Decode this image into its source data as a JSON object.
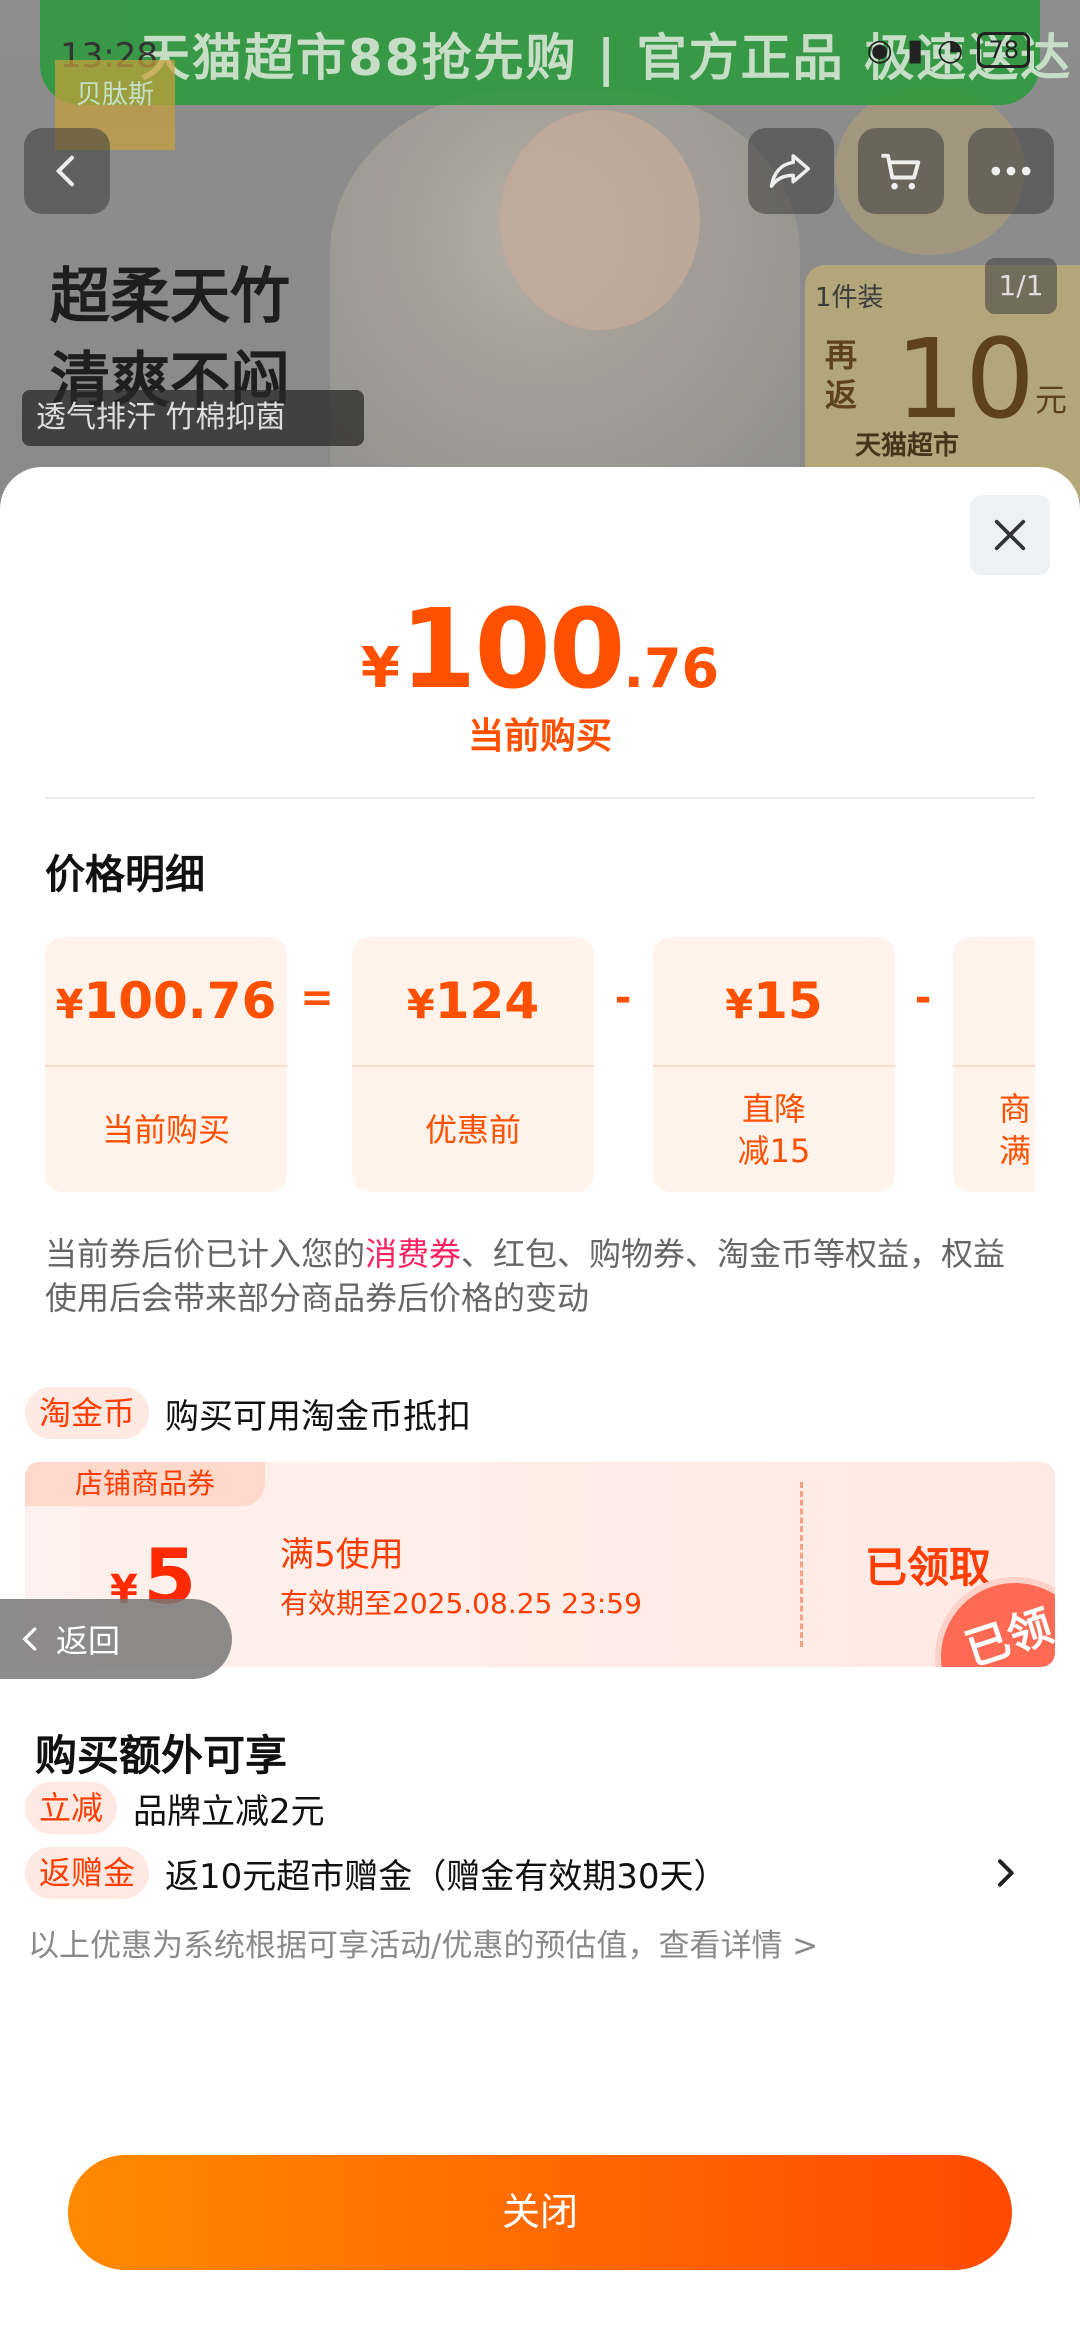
{
  "status_bar": {
    "time": "13:28",
    "battery": "78"
  },
  "background": {
    "banner": "天猫超市88抢先购 | 官方正品 极速送达",
    "brand": "贝肽斯",
    "headline_line1": "超柔天竹",
    "headline_line2": "清爽不闷",
    "tag": "透气排汗 竹棉抑菌",
    "pager": "1/1",
    "side_card": {
      "top": "1件装",
      "rebate": "再返",
      "amount": "10",
      "unit": "元",
      "footer": "天猫超市"
    }
  },
  "sheet": {
    "price": {
      "currency": "¥",
      "integer": "100",
      "decimal": ".76",
      "label": "当前购买"
    },
    "section_title": "价格明细",
    "breakdown": [
      {
        "amount": "100.76",
        "label": "当前购买"
      },
      {
        "amount": "124",
        "label": "优惠前"
      },
      {
        "amount": "15",
        "label": "直降\n减15"
      },
      {
        "amount": "",
        "label": "商\n满"
      }
    ],
    "operators": [
      "=",
      "-",
      "-"
    ],
    "note_prefix": "当前券后价已计入您的",
    "note_highlight": "消费券",
    "note_suffix": "、红包、购物券、淘金币等权益，权益使用后会带来部分商品券后价格的变动",
    "taojinbi": {
      "pill": "淘金币",
      "text": "购买可用淘金币抵扣"
    },
    "coupon": {
      "tag": "店铺商品券",
      "currency": "¥",
      "value": "5",
      "condition": "满5使用",
      "expiry": "有效期至2025.08.25 23:59",
      "status": "已领取",
      "stamp": "已领"
    },
    "extra_title": "购买额外可享",
    "benefits": [
      {
        "pill": "立减",
        "text": "品牌立减2元"
      },
      {
        "pill": "返赠金",
        "text": "返10元超市赠金（赠金有效期30天）"
      }
    ],
    "footnote": "以上优惠为系统根据可享活动/优惠的预估值，查看详情 >",
    "close_button": "关闭"
  },
  "back_float": "返回",
  "colors": {
    "accent": "#ff5000",
    "coupon_red": "#ff3d00",
    "highlight": "#ff2060"
  }
}
